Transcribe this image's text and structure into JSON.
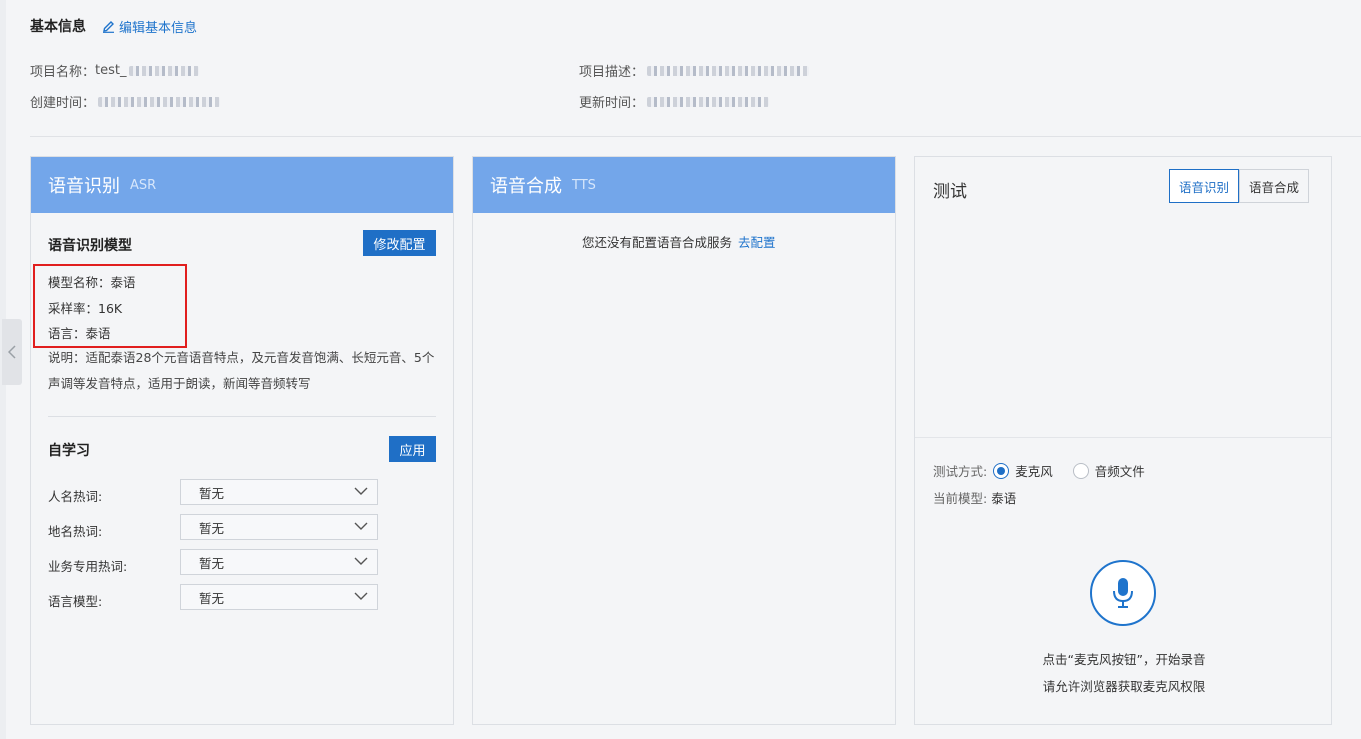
{
  "info": {
    "title": "基本信息",
    "edit_label": "编辑基本信息",
    "name_label": "项目名称：",
    "name_value": "test_",
    "desc_label": "项目描述：",
    "created_label": "创建时间：",
    "updated_label": "更新时间："
  },
  "asr": {
    "title": "语音识别",
    "subtitle": "ASR",
    "model_section": "语音识别模型",
    "modify_button": "修改配置",
    "model_name": "模型名称：泰语",
    "sample_rate": "采样率：16K",
    "language": "语言：泰语",
    "description": "说明：适配泰语28个元音语音特点，及元音发音饱满、长短元音、5个声调等发音特点，适用于朗读，新闻等音频转写",
    "self_learning": "自学习",
    "apply_button": "应用",
    "fields": [
      {
        "label": "人名热词:",
        "value": "暂无"
      },
      {
        "label": "地名热词:",
        "value": "暂无"
      },
      {
        "label": "业务专用热词:",
        "value": "暂无"
      },
      {
        "label": "语言模型:",
        "value": "暂无"
      }
    ]
  },
  "tts": {
    "title": "语音合成",
    "subtitle": "TTS",
    "empty_message": "您还没有配置语音合成服务",
    "configure_link": "去配置"
  },
  "test": {
    "title": "测试",
    "tabs": [
      "语音识别",
      "语音合成"
    ],
    "mode_label": "测试方式:",
    "option_mic": "麦克风",
    "option_file": "音频文件",
    "current_model_label": "当前模型:",
    "current_model_value": "泰语",
    "hint_line1": "点击“麦克风按钮”，开始录音",
    "hint_line2": "请允许浏览器获取麦克风权限"
  },
  "colors": {
    "accent": "#1f6fc6",
    "card_header": "#73a6ea",
    "highlight_box": "#e11e1e"
  }
}
